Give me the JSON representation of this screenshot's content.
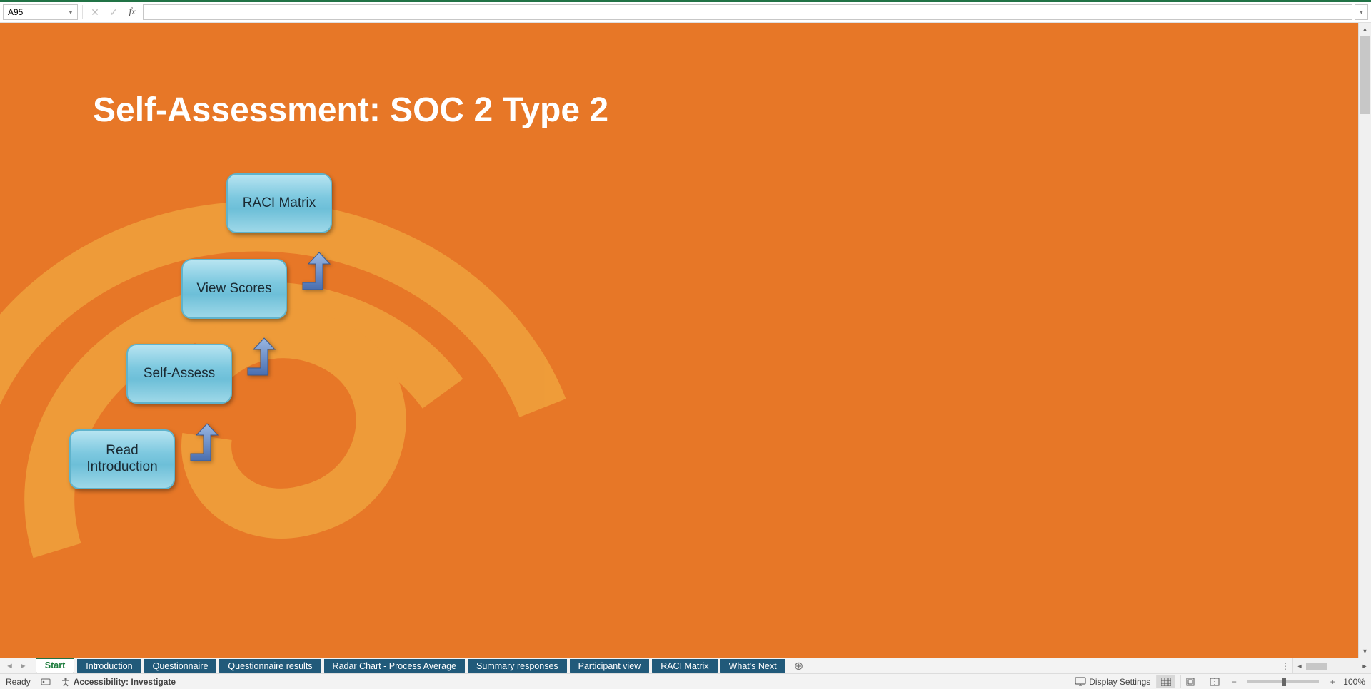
{
  "formula_bar": {
    "name_box_value": "A95",
    "formula_value": ""
  },
  "page": {
    "title": "Self-Assessment: SOC 2 Type 2"
  },
  "steps": {
    "s1": "Read Introduction",
    "s2": "Self-Assess",
    "s3": "View Scores",
    "s4": "RACI Matrix"
  },
  "tabs": [
    {
      "label": "Start",
      "active": true
    },
    {
      "label": "Introduction",
      "active": false
    },
    {
      "label": "Questionnaire",
      "active": false
    },
    {
      "label": "Questionnaire results",
      "active": false
    },
    {
      "label": "Radar Chart - Process Average",
      "active": false
    },
    {
      "label": "Summary responses",
      "active": false
    },
    {
      "label": "Participant view",
      "active": false
    },
    {
      "label": "RACI Matrix",
      "active": false
    },
    {
      "label": "What's Next",
      "active": false
    }
  ],
  "status": {
    "ready": "Ready",
    "accessibility": "Accessibility: Investigate",
    "display_settings": "Display Settings",
    "zoom": "100%"
  }
}
